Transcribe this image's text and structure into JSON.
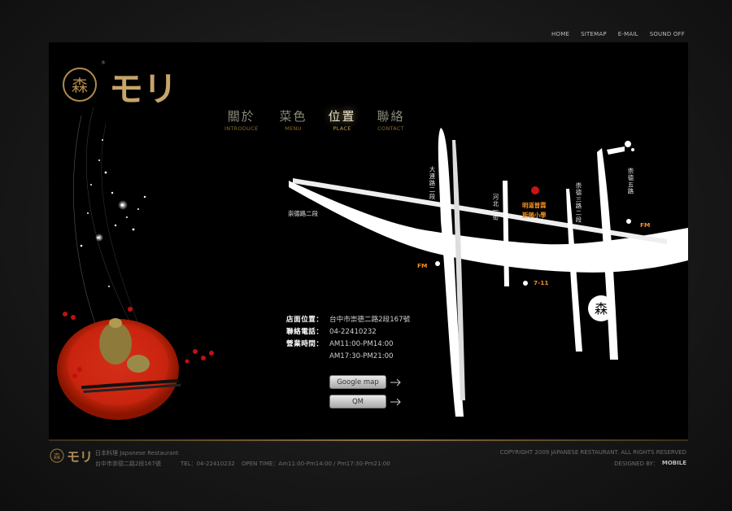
{
  "top_nav": {
    "home": "HOME",
    "sitemap": "SITEMAP",
    "email": "E-MAIL",
    "sound": "SOUND OFF"
  },
  "brand": {
    "mark": "森",
    "name": "モリ",
    "reg": "®"
  },
  "main_nav": [
    {
      "zh": "關於",
      "en": "INTRODUCE"
    },
    {
      "zh": "菜色",
      "en": "MENU"
    },
    {
      "zh": "位置",
      "en": "PLACE"
    },
    {
      "zh": "聯絡",
      "en": "CONTACT"
    }
  ],
  "map": {
    "road_chongde2": "崇德路二段",
    "road_dalian2": "大連路二段",
    "road_hebei1": "河北一街",
    "road_chongde3": "崇德三路二段",
    "road_chongde5": "崇德五路",
    "school": "明道普霖斯頓小學",
    "fm1": "FM",
    "fm2": "FM",
    "seven": "7-11"
  },
  "info": {
    "address_label": "店面位置：",
    "address": "台中市崇德二路2段167號",
    "phone_label": "聯絡電話：",
    "phone": "04-22410232",
    "hours_label": "營業時間：",
    "hours1": "AM11:00-PM14:00",
    "hours2": "AM17:30-PM21:00"
  },
  "buttons": {
    "google_map": "Google map",
    "qm": "QM"
  },
  "footer": {
    "cuisine": "日本料理 Japanese Restaurant",
    "address": "台中市崇德二路2段167號",
    "tel": "TEL：04-22410232",
    "open": "OPEN TIME：Am11:00-Pm14:00 / Pm17:30-Pm21:00",
    "copyright": "COPYRIGHT 2009 JAPANESE RESTAURANT. ALL RIGHTS RESERVED",
    "designed": "DESIGNED BY：",
    "designer": "MOBILE"
  },
  "colors": {
    "accent": "#f29122",
    "gold": "#8c6a2a",
    "stage": "#000000"
  }
}
